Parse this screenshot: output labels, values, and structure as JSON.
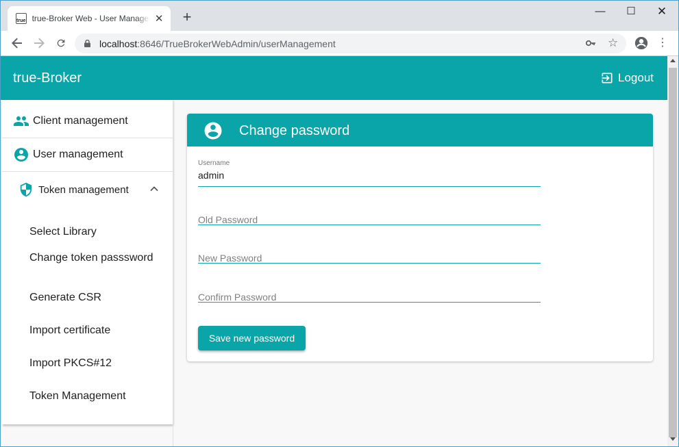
{
  "browser": {
    "tab_title": "true-Broker Web - User Management",
    "favicon_text": "true",
    "url_host": "localhost",
    "url_path": ":8646/TrueBrokerWebAdmin/userManagement"
  },
  "app": {
    "title": "true-Broker",
    "logout_label": "Logout",
    "accent_color": "#09a5a8"
  },
  "sidebar": {
    "items": [
      {
        "label": "Client management",
        "icon": "people-icon"
      },
      {
        "label": "User management",
        "icon": "account-circle-icon"
      }
    ],
    "group": {
      "label": "Token management",
      "icon": "shield-icon",
      "expanded": true,
      "sub_items": [
        {
          "label": "Select Library"
        },
        {
          "label": "Change token passsword"
        },
        {
          "label": "Generate CSR"
        },
        {
          "label": "Import certificate"
        },
        {
          "label": "Import PKCS#12"
        },
        {
          "label": "Token Management"
        }
      ]
    }
  },
  "card": {
    "title": "Change password",
    "username_label": "Username",
    "username_value": "admin",
    "old_password_placeholder": "Old Password",
    "new_password_placeholder": "New Password",
    "confirm_password_placeholder": "Confirm Password",
    "save_label": "Save new password"
  }
}
